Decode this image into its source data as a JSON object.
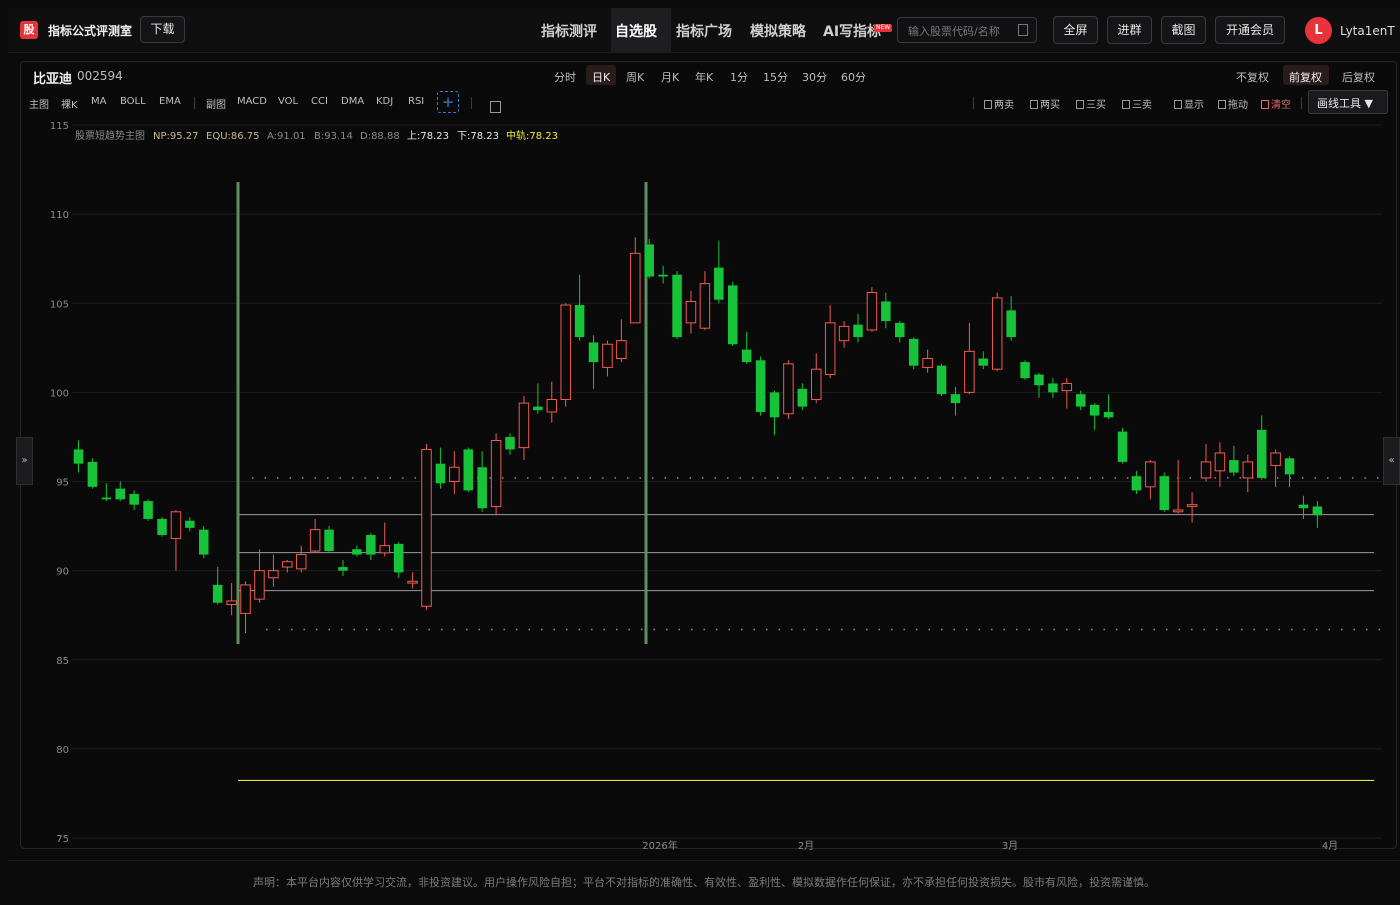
{
  "app": {
    "logo": "股",
    "title": "指标公式评测室",
    "download": "下载"
  },
  "nav": [
    {
      "label": "指标测评",
      "x": 541,
      "active": false
    },
    {
      "label": "自选股",
      "x": 615,
      "active": true
    },
    {
      "label": "指标广场",
      "x": 676,
      "active": false
    },
    {
      "label": "模拟策略",
      "x": 750,
      "active": false
    },
    {
      "label": "AI写指标",
      "x": 823,
      "active": false
    }
  ],
  "new_badge": "NEW",
  "search": {
    "placeholder": "输入股票代码/名称"
  },
  "actions": [
    "全屏",
    "进群",
    "截图",
    "开通会员"
  ],
  "user": {
    "avatar": "L",
    "name": "Lyta1enT"
  },
  "stock": {
    "name": "比亚迪",
    "code": "002594"
  },
  "periods": [
    "分时",
    "日K",
    "周K",
    "月K",
    "年K",
    "1分",
    "15分",
    "30分",
    "60分"
  ],
  "active_period": "日K",
  "adjust": [
    "不复权",
    "前复权",
    "后复权"
  ],
  "active_adjust": "前复权",
  "indicators_main_label": "主图",
  "indicators_main": [
    "裸K",
    "MA",
    "BOLL",
    "EMA"
  ],
  "indicators_sub_label": "副图",
  "indicators_sub": [
    "MACD",
    "VOL",
    "CCI",
    "DMA",
    "KDJ",
    "RSI"
  ],
  "tools": [
    {
      "label": "两卖",
      "red": false
    },
    {
      "label": "两买",
      "red": false
    },
    {
      "label": "三买",
      "red": false
    },
    {
      "label": "三卖",
      "red": false
    },
    {
      "label": "显示",
      "red": false
    },
    {
      "label": "拖动",
      "red": false
    },
    {
      "label": "清空",
      "red": true
    }
  ],
  "draw_tool": "画线工具 ▼",
  "legend": {
    "name": "股票短趋势主图",
    "items": [
      {
        "label": "NP:95.27",
        "color": "#c9b98b"
      },
      {
        "label": "EQU:86.75",
        "color": "#c9b98b"
      },
      {
        "label": "A:91.01",
        "color": "#8a8a8a"
      },
      {
        "label": "B:93.14",
        "color": "#8a8a8a"
      },
      {
        "label": "D:88.88",
        "color": "#8a8a8a"
      },
      {
        "label": "上:78.23",
        "color": "#e6e6e6"
      },
      {
        "label": "下:78.23",
        "color": "#e6e6e6"
      },
      {
        "label": "中轨:78.23",
        "color": "#f2ec3a"
      }
    ]
  },
  "colors": {
    "up": "#ef5b4f",
    "down": "#17c338",
    "vline": "#5c8f5c",
    "yellow": "#e6e23a"
  },
  "chart_data": {
    "type": "candlestick",
    "ylim": [
      75,
      115
    ],
    "yticks": [
      75,
      80,
      85,
      90,
      95,
      100,
      105,
      110,
      115
    ],
    "xticks": [
      "2026年",
      "2月",
      "3月",
      "4月"
    ],
    "levels": {
      "upper_dotted": 95.2,
      "lower_dotted": 86.7,
      "line_a": 93.14,
      "line_b": 91.01,
      "line_c": 88.88,
      "yellow": 78.23
    },
    "candles": [
      [
        96.8,
        96.0,
        97.3,
        95.5
      ],
      [
        96.1,
        94.7,
        96.3,
        94.6
      ],
      [
        94.1,
        94.0,
        94.9,
        93.9
      ],
      [
        94.6,
        94.0,
        95.0,
        93.9
      ],
      [
        94.3,
        93.7,
        94.5,
        93.4
      ],
      [
        93.9,
        92.9,
        94.0,
        92.8
      ],
      [
        92.9,
        92.0,
        93.0,
        91.9
      ],
      [
        91.8,
        93.3,
        93.4,
        90.0
      ],
      [
        92.8,
        92.4,
        93.0,
        92.2
      ],
      [
        92.3,
        90.9,
        92.5,
        90.7
      ],
      [
        89.2,
        88.2,
        90.2,
        88.1
      ],
      [
        88.1,
        88.3,
        89.3,
        87.5
      ],
      [
        87.6,
        89.2,
        89.4,
        86.5
      ],
      [
        88.4,
        90.0,
        91.2,
        88.2
      ],
      [
        89.6,
        90.0,
        90.9,
        89.1
      ],
      [
        90.2,
        90.5,
        90.6,
        89.9
      ],
      [
        90.1,
        90.9,
        91.4,
        89.9
      ],
      [
        91.1,
        92.3,
        92.9,
        91.0
      ],
      [
        92.3,
        91.1,
        92.5,
        91.0
      ],
      [
        90.2,
        90.0,
        90.6,
        89.7
      ],
      [
        91.2,
        90.9,
        91.4,
        90.8
      ],
      [
        92.0,
        90.9,
        92.1,
        90.6
      ],
      [
        91.0,
        91.4,
        92.7,
        90.8
      ],
      [
        91.5,
        89.9,
        91.6,
        89.6
      ],
      [
        89.3,
        89.4,
        89.9,
        89.0
      ],
      [
        88.0,
        96.8,
        97.1,
        87.8
      ],
      [
        96.0,
        94.9,
        96.9,
        94.6
      ],
      [
        95.0,
        95.8,
        96.7,
        94.3
      ],
      [
        96.8,
        94.5,
        96.9,
        94.4
      ],
      [
        95.8,
        93.5,
        96.7,
        93.3
      ],
      [
        93.6,
        97.3,
        97.7,
        93.1
      ],
      [
        97.5,
        96.8,
        97.7,
        96.5
      ],
      [
        96.9,
        99.4,
        99.8,
        96.2
      ],
      [
        99.2,
        99.0,
        100.5,
        98.8
      ],
      [
        98.9,
        99.6,
        100.6,
        98.3
      ],
      [
        99.6,
        104.9,
        105.0,
        99.2
      ],
      [
        104.9,
        103.1,
        106.6,
        102.9
      ],
      [
        102.8,
        101.7,
        103.2,
        100.2
      ],
      [
        101.4,
        102.7,
        102.9,
        100.9
      ],
      [
        101.9,
        102.9,
        104.1,
        101.7
      ],
      [
        103.9,
        107.8,
        108.7,
        103.9
      ],
      [
        108.3,
        106.5,
        108.6,
        106.4
      ],
      [
        106.6,
        106.5,
        107.1,
        106.1
      ],
      [
        106.6,
        103.1,
        106.8,
        103.0
      ],
      [
        103.9,
        105.1,
        105.7,
        103.3
      ],
      [
        103.6,
        106.1,
        106.8,
        103.5
      ],
      [
        107.0,
        105.2,
        108.5,
        105.0
      ],
      [
        106.0,
        102.7,
        106.2,
        102.6
      ],
      [
        102.4,
        101.7,
        103.4,
        101.6
      ],
      [
        101.8,
        98.9,
        102.0,
        98.7
      ],
      [
        100.0,
        98.6,
        100.1,
        97.6
      ],
      [
        98.8,
        101.6,
        101.8,
        98.5
      ],
      [
        100.2,
        99.2,
        100.5,
        99.0
      ],
      [
        99.6,
        101.3,
        102.2,
        99.4
      ],
      [
        101.0,
        103.9,
        104.9,
        100.8
      ],
      [
        102.9,
        103.7,
        104.0,
        102.5
      ],
      [
        103.8,
        103.1,
        104.4,
        102.8
      ],
      [
        103.5,
        105.6,
        105.9,
        103.4
      ],
      [
        105.1,
        104.0,
        105.6,
        103.6
      ],
      [
        103.9,
        103.1,
        104.0,
        102.8
      ],
      [
        103.0,
        101.5,
        103.1,
        101.3
      ],
      [
        101.4,
        101.9,
        102.4,
        101.1
      ],
      [
        101.5,
        99.9,
        101.6,
        99.8
      ],
      [
        99.9,
        99.4,
        100.3,
        98.7
      ],
      [
        100.0,
        102.3,
        103.9,
        99.9
      ],
      [
        101.9,
        101.5,
        102.3,
        101.3
      ],
      [
        101.3,
        105.3,
        105.6,
        101.2
      ],
      [
        104.6,
        103.1,
        105.4,
        102.9
      ],
      [
        101.7,
        100.8,
        101.8,
        100.7
      ],
      [
        101.0,
        100.4,
        101.1,
        99.7
      ],
      [
        100.5,
        100.0,
        100.8,
        99.7
      ],
      [
        100.1,
        100.5,
        100.8,
        99.1
      ],
      [
        99.9,
        99.2,
        100.1,
        99.0
      ],
      [
        99.3,
        98.7,
        99.4,
        97.9
      ],
      [
        98.9,
        98.6,
        99.9,
        98.5
      ],
      [
        97.8,
        96.1,
        98.0,
        96.0
      ],
      [
        95.3,
        94.5,
        95.6,
        94.3
      ],
      [
        94.7,
        96.1,
        96.2,
        94.0
      ],
      [
        95.3,
        93.4,
        95.5,
        93.3
      ],
      [
        93.3,
        93.4,
        96.2,
        93.2
      ],
      [
        93.6,
        93.7,
        94.4,
        92.7
      ],
      [
        95.2,
        96.1,
        97.1,
        95.0
      ],
      [
        95.6,
        96.6,
        97.2,
        94.7
      ],
      [
        96.2,
        95.5,
        97.0,
        95.3
      ],
      [
        95.2,
        96.1,
        96.5,
        94.4
      ],
      [
        97.9,
        95.2,
        98.7,
        95.1
      ],
      [
        95.9,
        96.6,
        96.8,
        94.7
      ],
      [
        96.3,
        95.4,
        96.4,
        94.7
      ],
      [
        93.7,
        93.5,
        94.2,
        92.9
      ],
      [
        93.6,
        93.1,
        93.9,
        92.4
      ]
    ]
  }
}
